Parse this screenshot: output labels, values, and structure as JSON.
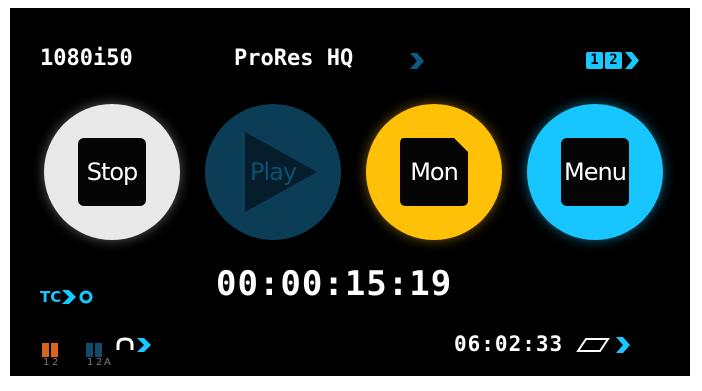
{
  "status": {
    "video_format": "1080i50",
    "codec": "ProRes HQ",
    "channel_1": "1",
    "channel_2": "2",
    "accent_color": "#19c8ff"
  },
  "buttons": {
    "stop": "Stop",
    "play": "Play",
    "mon": "Mon",
    "menu": "Menu"
  },
  "timecode": {
    "label": "TC",
    "value": "00:00:15:19"
  },
  "media": {
    "remaining_time": "06:02:33"
  },
  "audio": {
    "input_labels": [
      "1",
      "2"
    ],
    "output_labels": [
      "1",
      "2",
      "A"
    ]
  }
}
